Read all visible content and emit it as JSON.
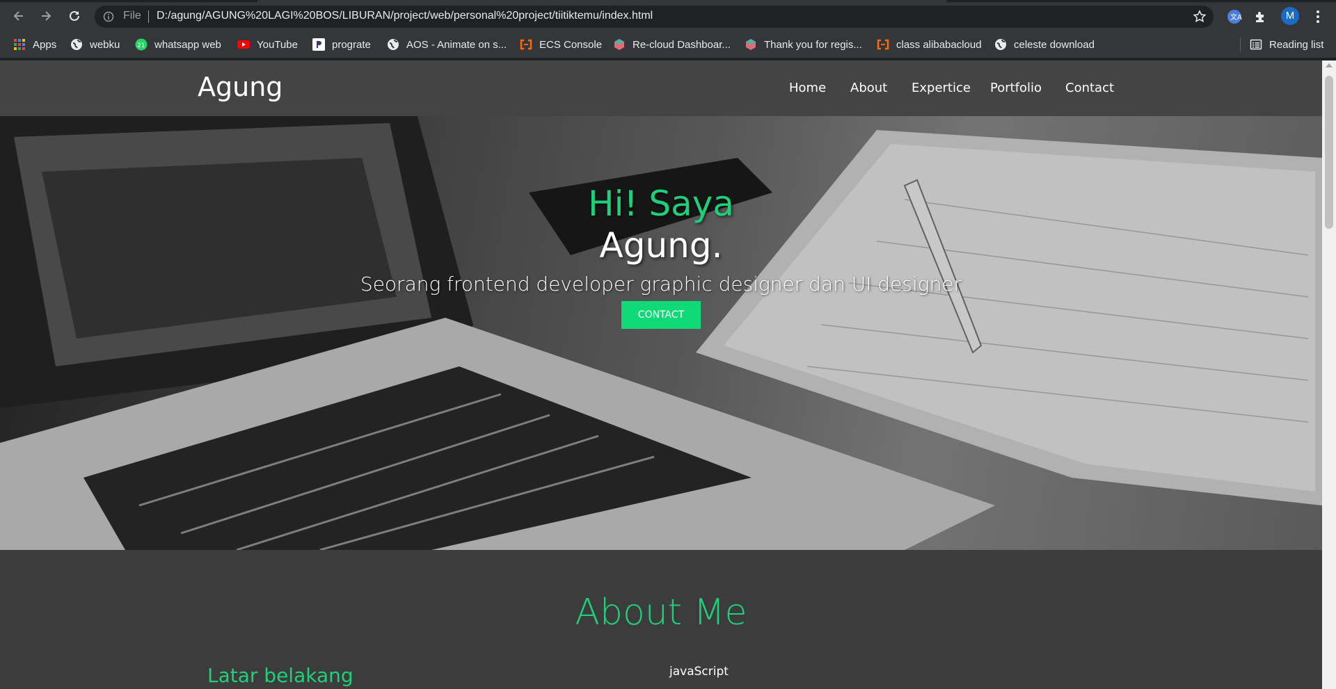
{
  "browser": {
    "omnibox": {
      "scheme_label": "File",
      "url": "D:/agung/AGUNG%20LAGI%20BOS/LIBURAN/project/web/personal%20project/tiitiktemu/index.html"
    },
    "profile_initial": "M",
    "bookmarks": [
      {
        "label": "Apps",
        "icon": "apps-grid-icon",
        "color": "#4285f4"
      },
      {
        "label": "webku",
        "icon": "globe-icon",
        "color": "#e8eaed"
      },
      {
        "label": "whatsapp web",
        "icon": "whatsapp-icon",
        "color": "#25d366",
        "badge": "21"
      },
      {
        "label": "YouTube",
        "icon": "youtube-icon",
        "color": "#ff0000"
      },
      {
        "label": "prograte",
        "icon": "prograte-icon",
        "color": "#ffffff"
      },
      {
        "label": "AOS - Animate on s...",
        "icon": "globe-icon",
        "color": "#e8eaed"
      },
      {
        "label": "ECS Console",
        "icon": "alibaba-cloud-icon",
        "color": "#ff6a00"
      },
      {
        "label": "Re-cloud Dashboar...",
        "icon": "recloud-icon",
        "color": "#e06c75"
      },
      {
        "label": "Thank you for regis...",
        "icon": "recloud-icon",
        "color": "#e06c75"
      },
      {
        "label": "class alibabacloud",
        "icon": "alibaba-cloud-icon",
        "color": "#ff6a00"
      },
      {
        "label": "celeste download",
        "icon": "globe-icon",
        "color": "#e8eaed"
      }
    ],
    "reading_list_label": "Reading list"
  },
  "site": {
    "brand": "Agung",
    "menu": [
      "Home",
      "About",
      "Expertice",
      "Portfolio",
      "Contact"
    ],
    "hero": {
      "greeting": "Hi! Saya",
      "name": "Agung.",
      "subtitle": "Seorang frontend developer graphic designer dan UI designer",
      "button_label": "CONTACT"
    },
    "about": {
      "title": "About Me",
      "left_heading": "Latar belakang",
      "right_text": "javaScript"
    },
    "colors": {
      "accent": "#1fd07a",
      "button": "#10d977",
      "nav_bg": "#444444",
      "page_bg": "#3c3c3c"
    }
  }
}
